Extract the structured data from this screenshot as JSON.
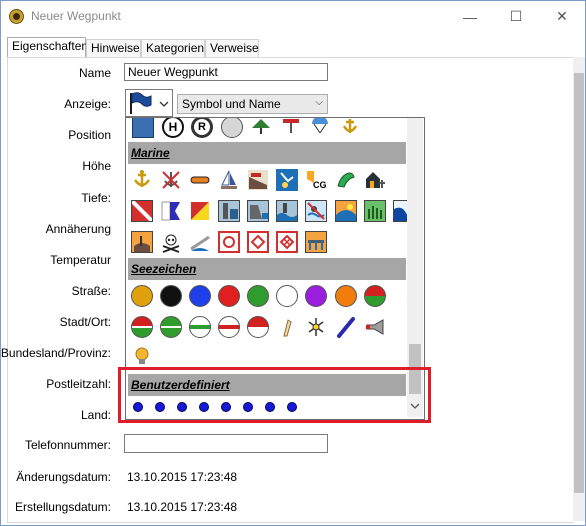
{
  "window": {
    "title": "Neuer Wegpunkt",
    "minimize": "—",
    "maximize": "☐",
    "close": "✕"
  },
  "tabs": [
    "Eigenschaften",
    "Hinweise",
    "Kategorien",
    "Verweise"
  ],
  "form": {
    "name_label": "Name",
    "name_value": "Neuer Wegpunkt",
    "anzeige_label": "Anzeige:",
    "anzeige_mode": "Symbol und Name",
    "position_label": "Position",
    "hoehe_label": "Höhe",
    "tiefe_label": "Tiefe:",
    "annaeherung_label": "Annäherung",
    "temperatur_label": "Temperatur",
    "strasse_label": "Straße:",
    "stadt_label": "Stadt/Ort:",
    "bundesland_label": "Bundesland/Provinz:",
    "postleitzahl_label": "Postleitzahl:",
    "land_label": "Land:",
    "telefon_label": "Telefonnummer:",
    "aenderung_label": "Änderungsdatum:",
    "aenderung_value": "13.10.2015 17:23:48",
    "erstellung_label": "Erstellungsdatum:",
    "erstellung_value": "13.10.2015 17:23:48"
  },
  "symbol_picker": {
    "selected_icon": "blue-flag-icon",
    "categories": [
      "Marine",
      "Seezeichen",
      "Benutzerdefiniert"
    ],
    "cg_label": "CG",
    "letters": [
      "H",
      "R"
    ],
    "custom_symbol_count": 8
  },
  "colors": {
    "highlight": "#e01e2b",
    "category_bg": "#a6a6a6",
    "custom_dot": "#1818d8"
  }
}
